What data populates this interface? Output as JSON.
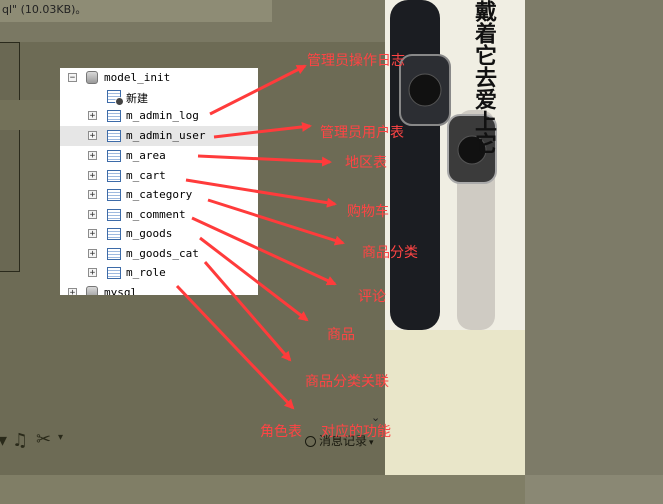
{
  "background": {
    "file_info_text": "ql\"  (10.03KB)。",
    "slogan": "戴着它去爱上它"
  },
  "tree": {
    "root_label": "model_init",
    "new_label": "新建",
    "tables": [
      "m_admin_log",
      "m_admin_user",
      "m_area",
      "m_cart",
      "m_category",
      "m_comment",
      "m_goods",
      "m_goods_cat",
      "m_role"
    ],
    "next_db_label": "mysql"
  },
  "annotations": {
    "admin_log": "管理员操作日志",
    "admin_user": "管理员用户表",
    "area": "地区表",
    "cart": "购物车",
    "category": "商品分类",
    "comment": "评论",
    "goods": "商品",
    "goods_cat": "商品分类关联",
    "role": "角色表",
    "function_note": "对应的功能"
  },
  "footer": {
    "message_record": "消息记录",
    "music_icon": "music-note-icon",
    "scissors_icon": "scissors-icon",
    "clock_icon": "clock-icon"
  },
  "colors": {
    "annotation": "#ff4444",
    "arrow": "#ff3b3b",
    "overlay": "#6d6b55"
  }
}
